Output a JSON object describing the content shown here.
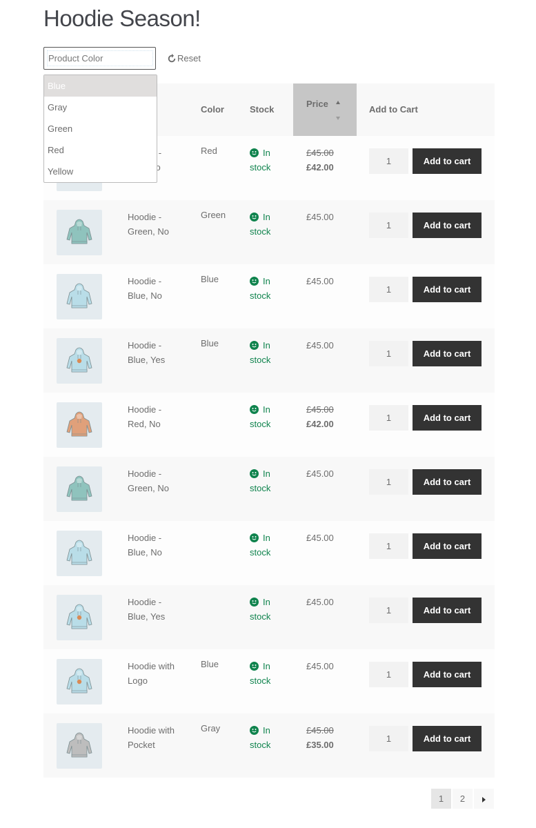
{
  "page": {
    "title": "Hoodie Season!"
  },
  "filter": {
    "placeholder": "Product Color",
    "value": "",
    "reset_label": "Reset",
    "options": [
      {
        "label": "Blue",
        "highlighted": true
      },
      {
        "label": "Gray",
        "highlighted": false
      },
      {
        "label": "Green",
        "highlighted": false
      },
      {
        "label": "Red",
        "highlighted": false
      },
      {
        "label": "Yellow",
        "highlighted": false
      }
    ]
  },
  "table": {
    "headers": {
      "image": "",
      "name": "",
      "color": "Color",
      "stock": "Stock",
      "price": "Price",
      "add_to_cart": "Add to Cart"
    },
    "sort": {
      "column": "price",
      "direction": "ascending"
    },
    "stock_color": "#0f834d",
    "button_color": "#333333",
    "rows": [
      {
        "name": "Hoodie - Red, No",
        "hoodie_color": "#e0a07a",
        "color": "Red",
        "stock": "In stock",
        "regular_price": "£45.00",
        "sale_price": "£42.00",
        "qty": "1",
        "button": "Add to cart"
      },
      {
        "name": "Hoodie - Green, No",
        "hoodie_color": "#8fc3bd",
        "color": "Green",
        "stock": "In stock",
        "regular_price": "£45.00",
        "sale_price": "",
        "qty": "1",
        "button": "Add to cart"
      },
      {
        "name": "Hoodie - Blue, No",
        "hoodie_color": "#b9dde8",
        "color": "Blue",
        "stock": "In stock",
        "regular_price": "£45.00",
        "sale_price": "",
        "qty": "1",
        "button": "Add to cart"
      },
      {
        "name": "Hoodie - Blue, Yes",
        "hoodie_color": "#b9dde8",
        "logo": true,
        "color": "Blue",
        "stock": "In stock",
        "regular_price": "£45.00",
        "sale_price": "",
        "qty": "1",
        "button": "Add to cart"
      },
      {
        "name": "Hoodie - Red, No",
        "hoodie_color": "#e0a07a",
        "color": "",
        "stock": "In stock",
        "regular_price": "£45.00",
        "sale_price": "£42.00",
        "qty": "1",
        "button": "Add to cart"
      },
      {
        "name": "Hoodie - Green, No",
        "hoodie_color": "#8fc3bd",
        "color": "",
        "stock": "In stock",
        "regular_price": "£45.00",
        "sale_price": "",
        "qty": "1",
        "button": "Add to cart"
      },
      {
        "name": "Hoodie - Blue, No",
        "hoodie_color": "#b9dde8",
        "color": "",
        "stock": "In stock",
        "regular_price": "£45.00",
        "sale_price": "",
        "qty": "1",
        "button": "Add to cart"
      },
      {
        "name": "Hoodie - Blue, Yes",
        "hoodie_color": "#b9dde8",
        "logo": true,
        "color": "",
        "stock": "In stock",
        "regular_price": "£45.00",
        "sale_price": "",
        "qty": "1",
        "button": "Add to cart"
      },
      {
        "name": "Hoodie with Logo",
        "hoodie_color": "#b9dde8",
        "logo": true,
        "color": "Blue",
        "stock": "In stock",
        "regular_price": "£45.00",
        "sale_price": "",
        "qty": "1",
        "button": "Add to cart"
      },
      {
        "name": "Hoodie with Pocket",
        "hoodie_color": "#bdbdbd",
        "color": "Gray",
        "stock": "In stock",
        "regular_price": "£45.00",
        "sale_price": "£35.00",
        "qty": "1",
        "button": "Add to cart"
      }
    ]
  },
  "pagination": {
    "pages": [
      "1",
      "2"
    ],
    "current": "1",
    "next_icon": "triangle-right"
  }
}
